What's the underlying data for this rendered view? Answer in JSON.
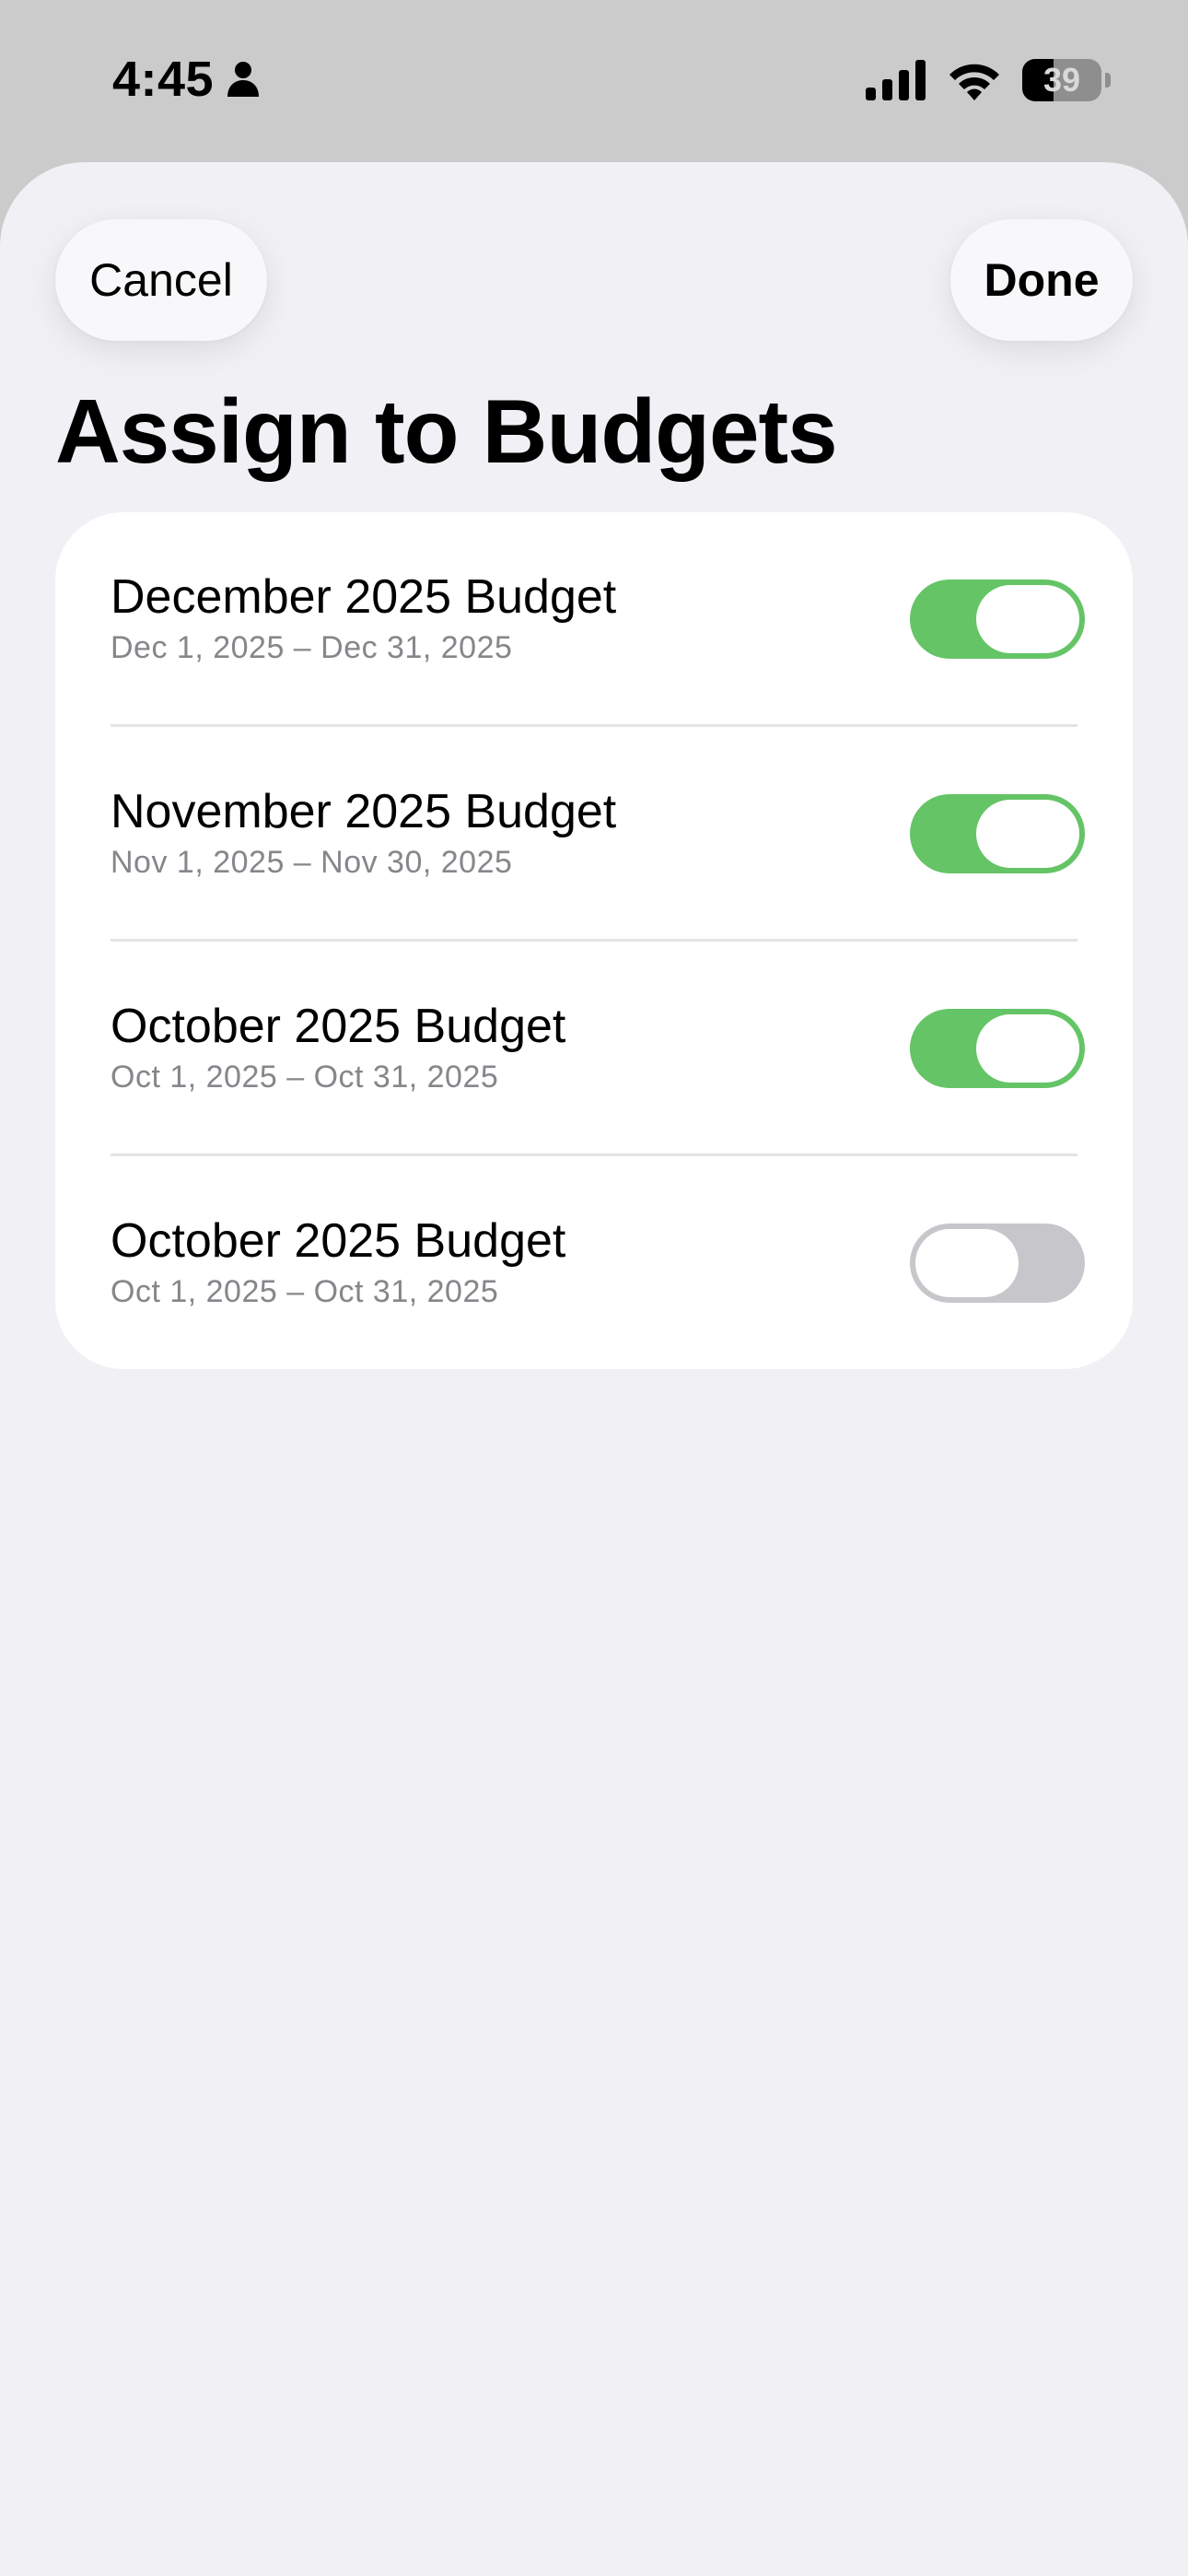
{
  "status_bar": {
    "time": "4:45",
    "battery": "39",
    "battery_level": 0.39
  },
  "header": {
    "cancel_label": "Cancel",
    "done_label": "Done",
    "title": "Assign to Budgets"
  },
  "budgets": [
    {
      "name": "December 2025 Budget",
      "range": "Dec 1, 2025 – Dec 31, 2025",
      "assigned": true
    },
    {
      "name": "November 2025 Budget",
      "range": "Nov 1, 2025 – Nov 30, 2025",
      "assigned": true
    },
    {
      "name": "October 2025 Budget",
      "range": "Oct 1, 2025 – Oct 31, 2025",
      "assigned": true
    },
    {
      "name": "October 2025 Budget",
      "range": "Oct 1, 2025 – Oct 31, 2025",
      "assigned": false
    }
  ],
  "colors": {
    "toggle_on": "#65c466",
    "toggle_off": "#c7c7cb",
    "sheet_background": "#f1f0f5"
  },
  "icons": [
    "person-icon",
    "cellular-signal-icon",
    "wifi-icon",
    "battery-icon"
  ]
}
